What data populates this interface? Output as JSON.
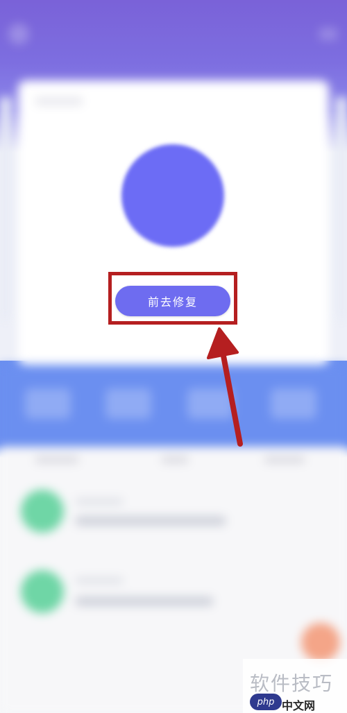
{
  "cta": {
    "label": "前去修复"
  },
  "watermark": {
    "main": "软件技巧",
    "sub": "中文网",
    "logo": "php"
  },
  "colors": {
    "accent": "#6e6cf0",
    "highlight": "#b51f20",
    "header": "#7a62d8",
    "band": "#6b8ff0",
    "status_green": "#6fd6a6",
    "fab_orange": "#f27a4b"
  },
  "icons": {
    "back": "back-icon",
    "menu": "menu-icon",
    "status": "status-circle-icon",
    "arrow": "pointer-arrow-icon"
  }
}
